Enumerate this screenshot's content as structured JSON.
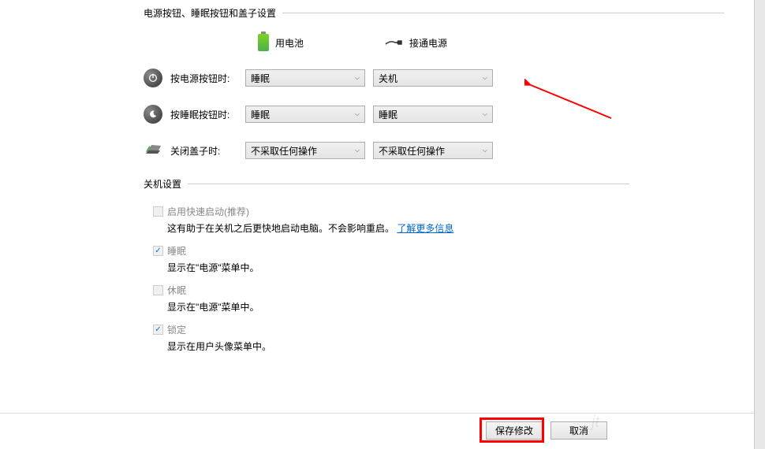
{
  "sections": {
    "power_buttons": {
      "title": "电源按钮、睡眠按钮和盖子设置",
      "columns": {
        "battery": "用电池",
        "plugged_in": "接通电源"
      },
      "rows": {
        "power_button": {
          "label": "按电源按钮时:",
          "battery_value": "睡眠",
          "plugged_value": "关机"
        },
        "sleep_button": {
          "label": "按睡眠按钮时:",
          "battery_value": "睡眠",
          "plugged_value": "睡眠"
        },
        "lid_close": {
          "label": "关闭盖子时:",
          "battery_value": "不采取任何操作",
          "plugged_value": "不采取任何操作"
        }
      }
    },
    "shutdown_settings": {
      "title": "关机设置",
      "items": {
        "fast_startup": {
          "label": "启用快速启动(推荐)",
          "desc_prefix": "这有助于在关机之后更快地启动电脑。不会影响重启。",
          "link": "了解更多信息",
          "checked": false,
          "disabled": true
        },
        "sleep": {
          "label": "睡眠",
          "desc": "显示在\"电源\"菜单中。",
          "checked": true,
          "disabled": true
        },
        "hibernate": {
          "label": "休眠",
          "desc": "显示在\"电源\"菜单中。",
          "checked": false,
          "disabled": true
        },
        "lock": {
          "label": "锁定",
          "desc": "显示在用户头像菜单中。",
          "checked": true,
          "disabled": true
        }
      }
    }
  },
  "footer": {
    "save": "保存修改",
    "cancel": "取消"
  }
}
